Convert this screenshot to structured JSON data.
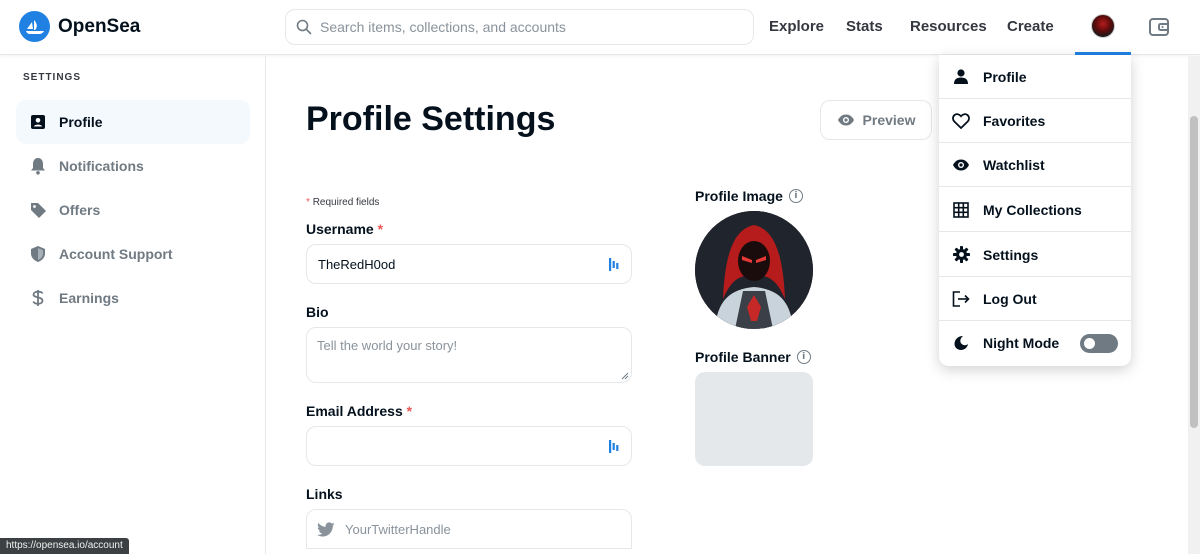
{
  "header": {
    "brand": "OpenSea",
    "search_placeholder": "Search items, collections, and accounts",
    "nav": [
      "Explore",
      "Stats",
      "Resources",
      "Create"
    ],
    "accent_color": "#2081e2"
  },
  "sidebar": {
    "section_label": "SETTINGS",
    "items": [
      {
        "label": "Profile",
        "icon": "profile-card-icon",
        "active": true
      },
      {
        "label": "Notifications",
        "icon": "bell-icon",
        "active": false
      },
      {
        "label": "Offers",
        "icon": "tag-icon",
        "active": false
      },
      {
        "label": "Account Support",
        "icon": "shield-icon",
        "active": false
      },
      {
        "label": "Earnings",
        "icon": "dollar-icon",
        "active": false
      }
    ]
  },
  "main": {
    "title": "Profile Settings",
    "preview_label": "Preview",
    "required_note": "Required fields",
    "username": {
      "label": "Username",
      "value": "TheRedH0od"
    },
    "bio": {
      "label": "Bio",
      "placeholder": "Tell the world your story!"
    },
    "email": {
      "label": "Email Address",
      "value": ""
    },
    "links": {
      "label": "Links",
      "twitter_placeholder": "YourTwitterHandle"
    },
    "profile_image_label": "Profile Image",
    "profile_banner_label": "Profile Banner",
    "info_glyph": "i"
  },
  "dropdown": {
    "items": [
      {
        "label": "Profile",
        "icon": "person-icon"
      },
      {
        "label": "Favorites",
        "icon": "heart-icon"
      },
      {
        "label": "Watchlist",
        "icon": "eye-icon"
      },
      {
        "label": "My Collections",
        "icon": "grid-icon"
      },
      {
        "label": "Settings",
        "icon": "gear-icon"
      },
      {
        "label": "Log Out",
        "icon": "logout-icon"
      },
      {
        "label": "Night Mode",
        "icon": "moon-icon",
        "toggle": false
      }
    ]
  },
  "status_bar": {
    "url": "https://opensea.io/account"
  }
}
